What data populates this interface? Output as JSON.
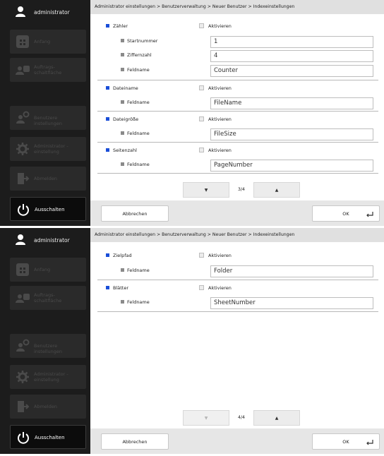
{
  "sidebar": {
    "user_name": "administrator",
    "items": [
      {
        "label": "Anfang"
      },
      {
        "label_line1": "Auftrags-",
        "label_line2": "schaltfläche"
      },
      {
        "label": "Benutzere instellungen"
      },
      {
        "label_line1": "Administrator -",
        "label_line2": "einstellung"
      },
      {
        "label": "Abmelden"
      },
      {
        "label": "Ausschalten"
      }
    ]
  },
  "screen1": {
    "breadcrumb": "Administrator einstellungen > Benutzerverwaltung > Neuer Benutzer > Indexeinstellungen",
    "counter": {
      "label": "Zähler",
      "activate": "Aktivieren",
      "start_label": "Startnummer",
      "start_value": "1",
      "digits_label": "Ziffernzahl",
      "digits_value": "4",
      "field_label": "Feldname",
      "field_value": "Counter"
    },
    "filename": {
      "label": "Dateiname",
      "activate": "Aktivieren",
      "field_label": "Feldname",
      "field_value": "FileName"
    },
    "filesize": {
      "label": "Dateigröße",
      "activate": "Aktivieren",
      "field_label": "Feldname",
      "field_value": "FileSize"
    },
    "pagecount": {
      "label": "Seitenzahl",
      "activate": "Aktivieren",
      "field_label": "Feldname",
      "field_value": "PageNumber"
    },
    "pager": {
      "count": "3/4"
    },
    "cancel_label": "Abbrechen",
    "ok_label": "OK"
  },
  "screen2": {
    "breadcrumb": "Administrator einstellungen > Benutzerverwaltung > Neuer Benutzer > Indexeinstellungen",
    "destpath": {
      "label": "Zielpfad",
      "activate": "Aktivieren",
      "field_label": "Feldname",
      "field_value": "Folder"
    },
    "sheets": {
      "label": "Blätter",
      "activate": "Aktivieren",
      "field_label": "Feldname",
      "field_value": "SheetNumber"
    },
    "pager": {
      "count": "4/4"
    },
    "cancel_label": "Abbrechen",
    "ok_label": "OK"
  },
  "colors": {
    "accent": "#1a4ed8",
    "sidebar_bg": "#1c1c1c",
    "breadcrumb_bg": "#e0e0e0"
  },
  "icons": [
    "user-icon",
    "home-icon",
    "job-button-icon",
    "user-settings-icon",
    "admin-settings-icon",
    "logout-icon",
    "power-icon",
    "arrow-down-icon",
    "arrow-up-icon",
    "enter-icon"
  ]
}
